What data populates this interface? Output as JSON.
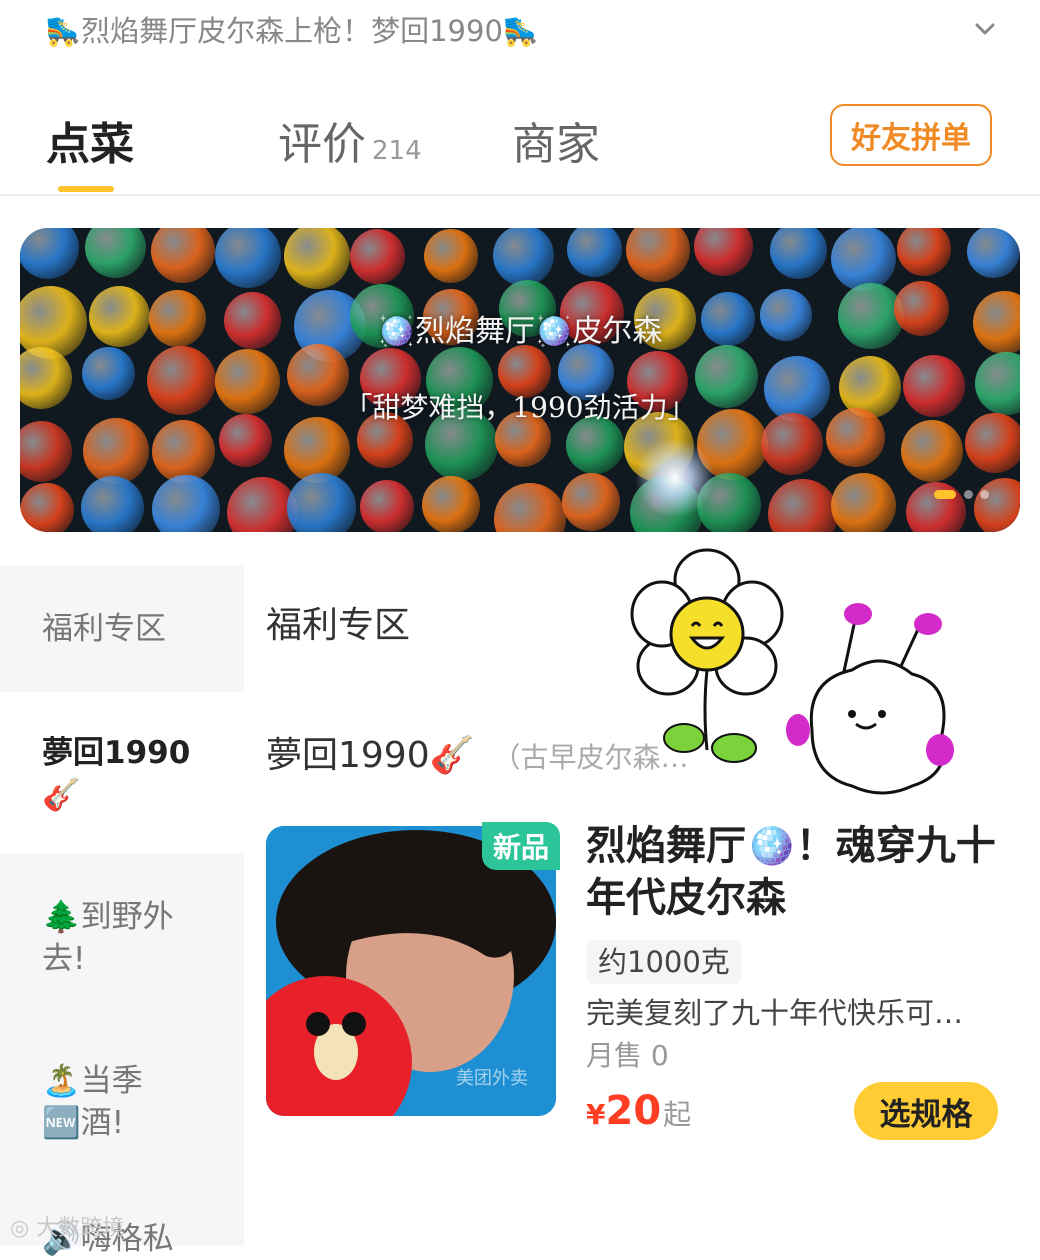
{
  "announcement": {
    "text": "🛼烈焰舞厅皮尔森上枪！梦回1990🛼"
  },
  "tabs": [
    {
      "label": "点菜"
    },
    {
      "label": "评价",
      "count": "214"
    },
    {
      "label": "商家"
    }
  ],
  "group_order_button": "好友拼单",
  "banner": {
    "title": "🪩烈焰舞厅🪩皮尔森",
    "subtitle": "「甜梦难挡，1990劲活力」"
  },
  "sidebar": {
    "items": [
      {
        "label": "福利专区"
      },
      {
        "label": "夢回1990🎸"
      },
      {
        "label": "🌲到野外去!"
      },
      {
        "label": "🏝️当季🆕酒!"
      },
      {
        "label": "🔊嗨格私"
      }
    ]
  },
  "main": {
    "section1_title": "福利专区",
    "section2_title": "夢回1990🎸",
    "section2_note": "（古早皮尔森…"
  },
  "product": {
    "badge": "新品",
    "name": "烈焰舞厅🪩！魂穿九十年代皮尔森",
    "weight": "约1000克",
    "description": "完美复刻了九十年代快乐可…",
    "sales": "月售 0",
    "price_currency": "¥",
    "price": "20",
    "price_suffix": "起",
    "select_button": "选规格",
    "image_watermark": "美团外卖"
  },
  "watermark": "大数跨境",
  "colors": {
    "accent_yellow": "#ffc32b",
    "orange": "#f08a24",
    "price_red": "#ff3d22",
    "badge_green": "#2cc59a"
  }
}
